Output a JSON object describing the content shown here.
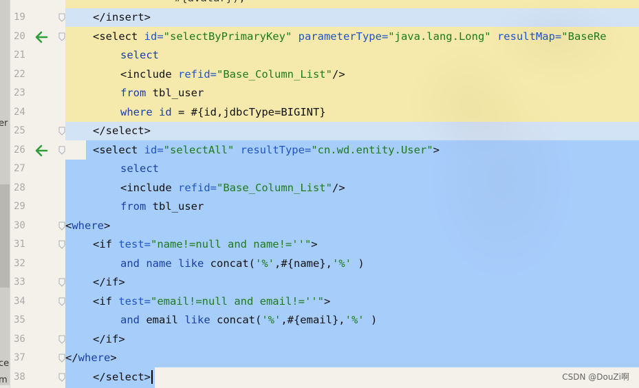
{
  "editor": {
    "top_partial_line": "#{avatar}),",
    "lines": [
      {
        "num": "19",
        "indent": 1,
        "segments": [
          [
            "tag",
            "</insert>"
          ]
        ]
      },
      {
        "num": "20",
        "indent": 1,
        "arrow": true,
        "segments": [
          [
            "tag",
            "<select "
          ],
          [
            "attr",
            "id="
          ],
          [
            "str",
            "\"selectByPrimaryKey\""
          ],
          [
            "tag",
            " "
          ],
          [
            "attr",
            "parameterType="
          ],
          [
            "str",
            "\"java.lang.Long\""
          ],
          [
            "tag",
            " "
          ],
          [
            "attr",
            "resultMap="
          ],
          [
            "str",
            "\"BaseRe"
          ]
        ]
      },
      {
        "num": "21",
        "indent": 2,
        "segments": [
          [
            "kw",
            "select"
          ]
        ]
      },
      {
        "num": "22",
        "indent": 2,
        "segments": [
          [
            "tag",
            "<include "
          ],
          [
            "attr",
            "refid="
          ],
          [
            "str",
            "\"Base_Column_List\""
          ],
          [
            "tag",
            "/>"
          ]
        ]
      },
      {
        "num": "23",
        "indent": 2,
        "segments": [
          [
            "kw",
            "from"
          ],
          [
            "tag",
            " tbl_user"
          ]
        ]
      },
      {
        "num": "24",
        "indent": 2,
        "segments": [
          [
            "kw",
            "where"
          ],
          [
            "tag",
            " "
          ],
          [
            "kw",
            "id"
          ],
          [
            "tag",
            " = #{id,jdbcType=BIGINT}"
          ]
        ]
      },
      {
        "num": "25",
        "indent": 1,
        "segments": [
          [
            "tag",
            "</select>"
          ]
        ]
      },
      {
        "num": "26",
        "indent": 1,
        "arrow": true,
        "segments": [
          [
            "tag",
            "<select "
          ],
          [
            "attr",
            "id="
          ],
          [
            "str",
            "\"selectAll\""
          ],
          [
            "tag",
            " "
          ],
          [
            "attr",
            "resultType="
          ],
          [
            "str",
            "\"cn.wd.entity.User\""
          ],
          [
            "tag",
            ">"
          ]
        ]
      },
      {
        "num": "27",
        "indent": 2,
        "segments": [
          [
            "kw",
            "select"
          ]
        ]
      },
      {
        "num": "28",
        "indent": 2,
        "segments": [
          [
            "tag",
            "<include "
          ],
          [
            "attr",
            "refid="
          ],
          [
            "str",
            "\"Base_Column_List\""
          ],
          [
            "tag",
            "/>"
          ]
        ]
      },
      {
        "num": "29",
        "indent": 2,
        "segments": [
          [
            "kw",
            "from"
          ],
          [
            "tag",
            " tbl_user"
          ]
        ]
      },
      {
        "num": "30",
        "indent": 0,
        "segments": [
          [
            "tag",
            "<"
          ],
          [
            "kw",
            "where"
          ],
          [
            "tag",
            ">"
          ]
        ]
      },
      {
        "num": "31",
        "indent": 1,
        "segments": [
          [
            "tag",
            "<if "
          ],
          [
            "attr",
            "test="
          ],
          [
            "str",
            "\"name!=null and name!=''\""
          ],
          [
            "tag",
            ">"
          ]
        ]
      },
      {
        "num": "32",
        "indent": 2,
        "segments": [
          [
            "kw",
            "and"
          ],
          [
            "tag",
            " "
          ],
          [
            "kw",
            "name"
          ],
          [
            "tag",
            " "
          ],
          [
            "kw",
            "like"
          ],
          [
            "tag",
            " concat("
          ],
          [
            "str",
            "'%'"
          ],
          [
            "tag",
            ",#{name},"
          ],
          [
            "str",
            "'%'"
          ],
          [
            "tag",
            " )"
          ]
        ]
      },
      {
        "num": "33",
        "indent": 1,
        "segments": [
          [
            "tag",
            "</if>"
          ]
        ]
      },
      {
        "num": "34",
        "indent": 1,
        "segments": [
          [
            "tag",
            "<if "
          ],
          [
            "attr",
            "test="
          ],
          [
            "str",
            "\"email!=null and email!=''\""
          ],
          [
            "tag",
            ">"
          ]
        ]
      },
      {
        "num": "35",
        "indent": 2,
        "segments": [
          [
            "kw",
            "and"
          ],
          [
            "tag",
            " email "
          ],
          [
            "kw",
            "like"
          ],
          [
            "tag",
            " concat("
          ],
          [
            "str",
            "'%'"
          ],
          [
            "tag",
            ",#{email},"
          ],
          [
            "str",
            "'%'"
          ],
          [
            "tag",
            " )"
          ]
        ]
      },
      {
        "num": "36",
        "indent": 1,
        "segments": [
          [
            "tag",
            "</if>"
          ]
        ]
      },
      {
        "num": "37",
        "indent": 0,
        "segments": [
          [
            "tag",
            "</"
          ],
          [
            "kw",
            "where"
          ],
          [
            "tag",
            ">"
          ]
        ]
      },
      {
        "num": "38",
        "indent": 1,
        "caret": true,
        "segments": [
          [
            "tag",
            "</select>"
          ]
        ]
      }
    ]
  },
  "left_panel": {
    "texts": [
      "er",
      "cel",
      "m"
    ]
  },
  "watermark": "CSDN @DouZi啊",
  "colors": {
    "selection_blue": "#96c4ff",
    "yellow_highlight": "#f5e8a0",
    "arrow_green": "#2e9b3c",
    "string_green": "#1e7a1e",
    "keyword_blue": "#1a3fa6"
  },
  "icons": [
    "gutter-arrow-icon",
    "fold-marker-icon"
  ]
}
